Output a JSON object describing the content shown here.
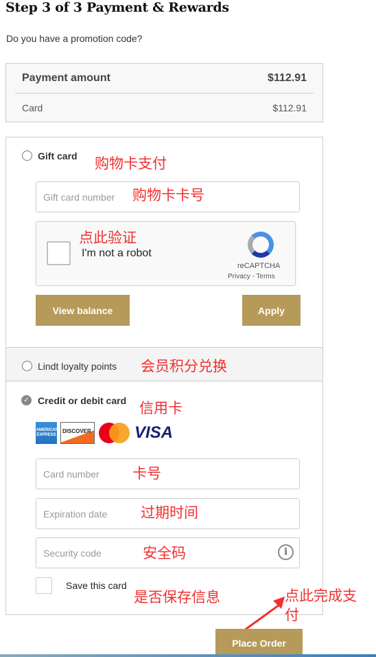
{
  "title": "Step 3 of 3 Payment & Rewards",
  "promo_link": "Do you have a promotion code?",
  "summary": {
    "label": "Payment amount",
    "total": "$112.91",
    "card_label": "Card",
    "card_amount": "$112.91"
  },
  "gift": {
    "label": "Gift card",
    "number_placeholder": "Gift card number",
    "view_balance": "View balance",
    "apply": "Apply"
  },
  "recaptcha": {
    "label": "I'm not a robot",
    "brand": "reCAPTCHA",
    "privacy": "Privacy",
    "sep": " - ",
    "terms": "Terms"
  },
  "loyalty": {
    "label": "Lindt loyalty points"
  },
  "card": {
    "label": "Credit or debit card",
    "number_placeholder": "Card number",
    "expiry_placeholder": "Expiration date",
    "cvv_placeholder": "Security code",
    "save_label": "Save this card",
    "brands": [
      "American Express",
      "Discover",
      "Mastercard",
      "VISA"
    ],
    "visa_text": "VISA",
    "discover_text": "DISCOVER"
  },
  "place_order": "Place Order",
  "annotations": {
    "gift": "购物卡支付",
    "gift_number": "购物卡卡号",
    "verify": "点此验证",
    "loyalty": "会员积分兑换",
    "credit": "信用卡",
    "card_number": "卡号",
    "expiry": "过期时间",
    "cvv": "安全码",
    "save": "是否保存信息",
    "place": "点此完成支付"
  },
  "colors": {
    "gold": "#b59a5a",
    "annotation": "#f03030"
  }
}
